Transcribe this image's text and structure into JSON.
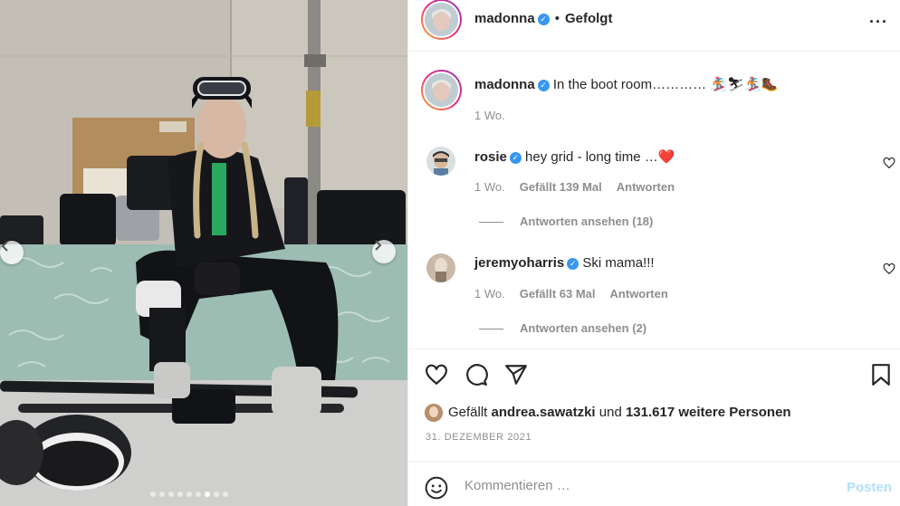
{
  "post": {
    "author": "madonna",
    "follow_status": "Gefolgt",
    "caption": "In the boot room…………",
    "caption_emoji": "🏂⛷🏂🥾",
    "caption_age": "1 Wo."
  },
  "comments": [
    {
      "user": "rosie",
      "text": "hey grid - long time …❤️",
      "age": "1 Wo.",
      "likes": "Gefällt 139 Mal",
      "reply": "Antworten",
      "view_replies": "Antworten ansehen (18)"
    },
    {
      "user": "jeremyoharris",
      "text": "Ski mama!!!",
      "age": "1 Wo.",
      "likes": "Gefällt 63 Mal",
      "reply": "Antworten",
      "view_replies": "Antworten ansehen (2)"
    }
  ],
  "likes_line": {
    "prefix": "Gefällt",
    "user": "andrea.sawatzki",
    "middle": "und",
    "count": "131.617 weitere Personen"
  },
  "date": "31. DEZEMBER 2021",
  "comment_input": {
    "placeholder": "Kommentieren …",
    "post_label": "Posten"
  },
  "carousel": {
    "slide_count": 9,
    "active_slide": 6
  },
  "colors": {
    "verified": "#3897f0",
    "post_disabled": "#b2dffc",
    "heart_red": "#e0245e"
  },
  "icons": [
    "verified-icon",
    "more-icon",
    "heart-icon",
    "comment-icon",
    "share-icon",
    "bookmark-icon",
    "emoji-icon",
    "chevron-left-icon",
    "chevron-right-icon"
  ]
}
